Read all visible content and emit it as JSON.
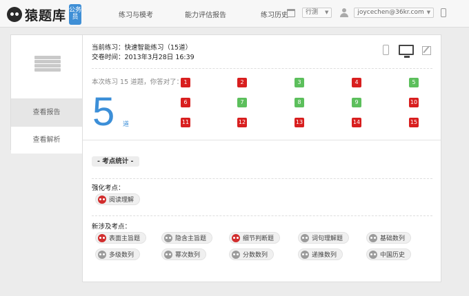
{
  "header": {
    "logo_text": "猿题库",
    "badge": "公务员",
    "nav": [
      "练习与模考",
      "能力评估报告",
      "练习历史"
    ],
    "subject_select": "行测",
    "user_email": "joycechen@36kr.com"
  },
  "left_nav": {
    "items": [
      "查看报告",
      "查看解析"
    ]
  },
  "report": {
    "current_label": "当前练习：快速智能练习（15道）",
    "submit_time": "交卷时间：2013年3月28日 16:39",
    "summary_text": "本次练习 15 道题，你答对了：",
    "correct_count": "5",
    "correct_unit": "道",
    "questions": [
      {
        "n": "1",
        "status": "wrong"
      },
      {
        "n": "2",
        "status": "wrong"
      },
      {
        "n": "3",
        "status": "right"
      },
      {
        "n": "4",
        "status": "wrong"
      },
      {
        "n": "5",
        "status": "right"
      },
      {
        "n": "6",
        "status": "wrong"
      },
      {
        "n": "7",
        "status": "right"
      },
      {
        "n": "8",
        "status": "right"
      },
      {
        "n": "9",
        "status": "right"
      },
      {
        "n": "10",
        "status": "wrong"
      },
      {
        "n": "11",
        "status": "wrong"
      },
      {
        "n": "12",
        "status": "wrong"
      },
      {
        "n": "13",
        "status": "wrong"
      },
      {
        "n": "14",
        "status": "wrong"
      },
      {
        "n": "15",
        "status": "wrong"
      }
    ]
  },
  "stats": {
    "button_label": "- 考点统计 -",
    "strengthen_title": "强化考点：",
    "strengthen_tags": [
      {
        "label": "阅读理解",
        "icon": "red"
      }
    ],
    "new_title": "新涉及考点：",
    "new_tags": [
      {
        "label": "表面主旨题",
        "icon": "red"
      },
      {
        "label": "隐含主旨题",
        "icon": "gray"
      },
      {
        "label": "细节判断题",
        "icon": "red"
      },
      {
        "label": "词句理解题",
        "icon": "gray"
      },
      {
        "label": "基础数列",
        "icon": "gray"
      },
      {
        "label": "多级数列",
        "icon": "gray"
      },
      {
        "label": "幂次数列",
        "icon": "gray"
      },
      {
        "label": "分数数列",
        "icon": "gray"
      },
      {
        "label": "递推数列",
        "icon": "gray"
      },
      {
        "label": "中国历史",
        "icon": "gray"
      }
    ]
  },
  "colors": {
    "accent": "#3c8fd8",
    "wrong": "#d81f1f",
    "right": "#5cbf5c"
  }
}
